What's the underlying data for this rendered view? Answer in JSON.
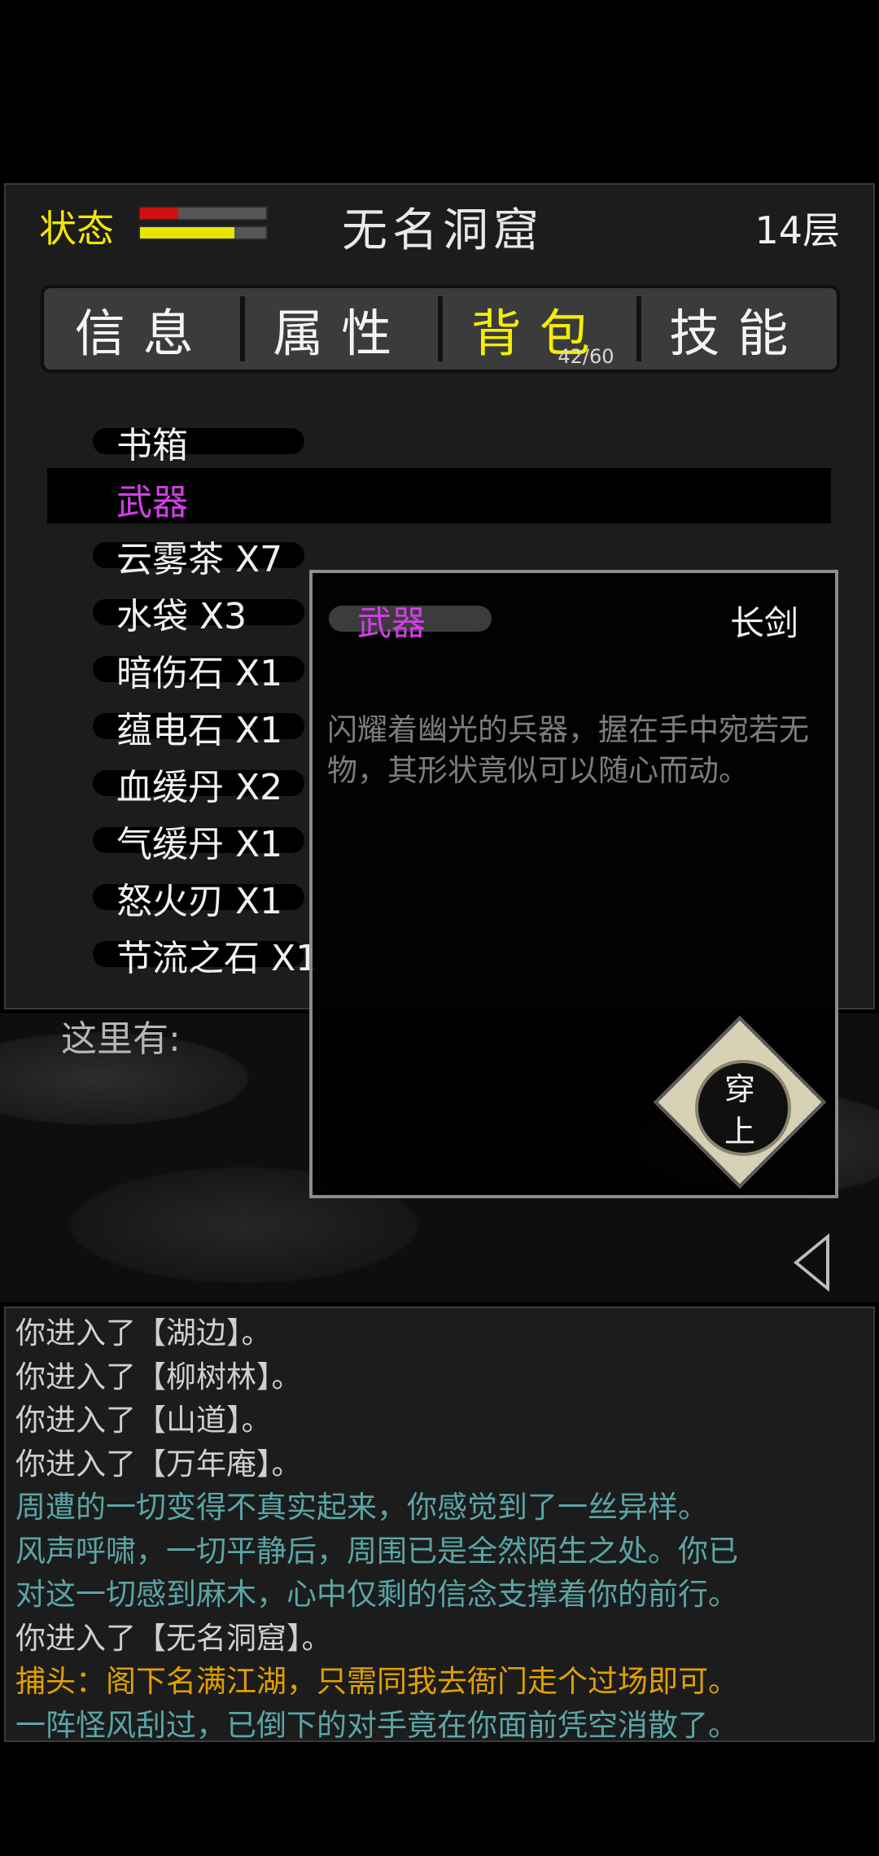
{
  "header": {
    "status_label": "状态",
    "hp_fraction": 0.3,
    "mp_fraction": 0.75,
    "location": "无名洞窟",
    "floor": "14层"
  },
  "tabs": [
    {
      "label": "信息"
    },
    {
      "label": "属性"
    },
    {
      "label": "背包",
      "count": "42/60",
      "active": true
    },
    {
      "label": "技能"
    }
  ],
  "inventory": [
    {
      "name": "书箱"
    },
    {
      "name": "武器",
      "selected": true
    },
    {
      "name": "云雾茶 X7"
    },
    {
      "name": "水袋 X3"
    },
    {
      "name": "暗伤石 X1"
    },
    {
      "name": "蕴电石 X1"
    },
    {
      "name": "血缓丹 X2"
    },
    {
      "name": "气缓丹 X1"
    },
    {
      "name": "怒火刃 X1"
    },
    {
      "name": "节流之石 X1"
    }
  ],
  "here_label": "这里有:",
  "popup": {
    "category": "武器",
    "item_name": "长剑",
    "description": "闪耀着幽光的兵器，握在手中宛若无物，其形状竟似可以随心而动。",
    "equip_label": "穿\n上"
  },
  "log": [
    {
      "text": "你进入了【湖边】。",
      "color": "white"
    },
    {
      "text": "你进入了【柳树林】。",
      "color": "white"
    },
    {
      "text": "你进入了【山道】。",
      "color": "white"
    },
    {
      "text": "你进入了【万年庵】。",
      "color": "white"
    },
    {
      "text": "周遭的一切变得不真实起来，你感觉到了一丝异样。",
      "color": "teal"
    },
    {
      "text": "风声呼啸，一切平静后，周围已是全然陌生之处。你已",
      "color": "teal"
    },
    {
      "text": "对这一切感到麻木，心中仅剩的信念支撑着你的前行。",
      "color": "teal"
    },
    {
      "text": "你进入了【无名洞窟】。",
      "color": "white"
    },
    {
      "text": "捕头：阁下名满江湖，只需同我去衙门走个过场即可。",
      "color": "orange"
    },
    {
      "text": "一阵怪风刮过，已倒下的对手竟在你面前凭空消散了。",
      "color": "teal"
    }
  ]
}
